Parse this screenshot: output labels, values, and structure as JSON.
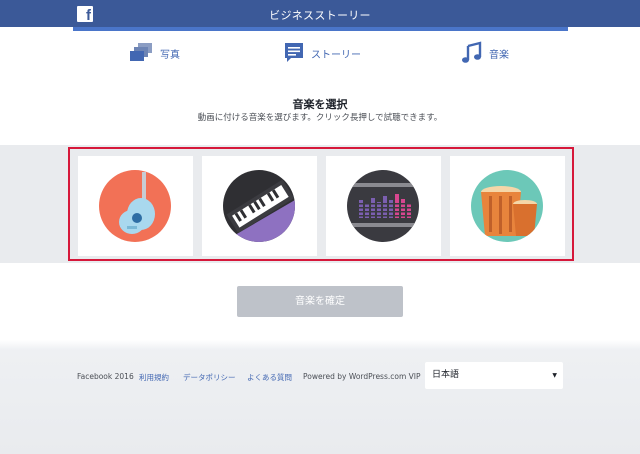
{
  "header": {
    "title": "ビジネスストーリー",
    "logo_letter": "f",
    "bg_color": "#3b5998"
  },
  "tabs": [
    {
      "label": "写真",
      "icon": "photos-icon"
    },
    {
      "label": "ストーリー",
      "icon": "story-icon"
    },
    {
      "label": "音楽",
      "icon": "music-note-icon"
    }
  ],
  "music_picker": {
    "title": "音楽を選択",
    "subtitle": "動画に付ける音楽を選びます。クリック長押しで試聴できます。",
    "options": [
      {
        "icon": "guitar-icon",
        "color": "#f27156"
      },
      {
        "icon": "keyboard-icon",
        "color": "#8e71c1"
      },
      {
        "icon": "equalizer-icon",
        "color": "#3a3a40"
      },
      {
        "icon": "drums-icon",
        "color": "#6cc8b8"
      }
    ],
    "selection_border_color": "#d6183a"
  },
  "confirm_button": {
    "label": "音楽を確定"
  },
  "footer": {
    "copyright": "Facebook 2016",
    "links": [
      "利用規約",
      "データポリシー",
      "よくある質問"
    ],
    "powered_by": "Powered by WordPress.com VIP",
    "language": "日本語"
  }
}
